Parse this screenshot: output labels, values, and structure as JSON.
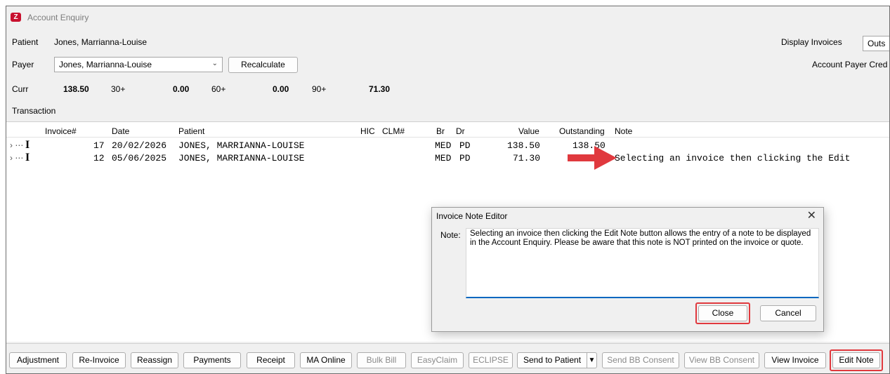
{
  "window": {
    "title": "Account Enquiry",
    "logo_glyph": "Z"
  },
  "header": {
    "patient_label": "Patient",
    "patient_name": "Jones, Marrianna-Louise",
    "payer_label": "Payer",
    "payer_value": "Jones, Marrianna-Louise",
    "recalculate_label": "Recalculate",
    "display_invoices_label": "Display Invoices",
    "display_invoices_value": "Outs",
    "account_payer_label": "Account Payer Cred"
  },
  "aging": {
    "curr_label": "Curr",
    "curr_value": "138.50",
    "d30_label": "30+",
    "d30_value": "0.00",
    "d60_label": "60+",
    "d60_value": "0.00",
    "d90_label": "90+",
    "d90_value": "71.30"
  },
  "transaction_label": "Transaction",
  "grid": {
    "columns": [
      "Invoice#",
      "Date",
      "Patient",
      "HIC",
      "CLM#",
      "Br",
      "Dr",
      "Value",
      "Outstanding",
      "Note"
    ],
    "rows": [
      {
        "invoice": "17",
        "date": "20/02/2026",
        "patient": "JONES, MARRIANNA-LOUISE",
        "br": "MED",
        "dr": "PD",
        "value": "138.50",
        "outstanding": "138.50",
        "note": ""
      },
      {
        "invoice": "12",
        "date": "05/06/2025",
        "patient": "JONES, MARRIANNA-LOUISE",
        "br": "MED",
        "dr": "PD",
        "value": "71.30",
        "outstanding": "",
        "note": "Selecting an invoice then clicking the Edit"
      }
    ]
  },
  "dialog": {
    "title": "Invoice Note Editor",
    "note_label": "Note:",
    "note_text": "Selecting an invoice then clicking the Edit Note button allows the entry of a note to be displayed in the Account Enquiry. Please be aware that this note is NOT printed on the invoice or quote.",
    "close_label": "Close",
    "cancel_label": "Cancel"
  },
  "toolbar": {
    "adjustment": "Adjustment",
    "reinvoice": "Re-Invoice",
    "reassign": "Reassign",
    "payments": "Payments",
    "receipt": "Receipt",
    "ma_online": "MA Online",
    "bulk_bill": "Bulk Bill",
    "easyclaim": "EasyClaim",
    "eclipse": "ECLIPSE",
    "send_to_patient": "Send to Patient",
    "send_bb_consent": "Send BB Consent",
    "view_bb_consent": "View BB Consent",
    "view_invoice": "View Invoice",
    "edit_note": "Edit Note"
  },
  "colors": {
    "highlight": "#e0393e",
    "arrow": "#e0393e",
    "focus": "#0067c0"
  }
}
